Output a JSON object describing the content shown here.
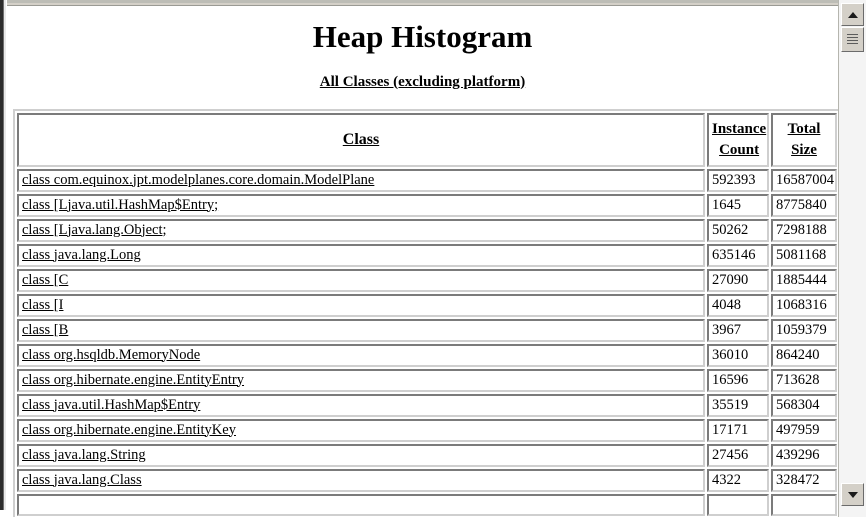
{
  "page": {
    "title": "Heap Histogram",
    "subtitle_link": "All Classes (excluding platform)"
  },
  "table": {
    "headers": {
      "class": "Class",
      "instance_count_line1": "Instance",
      "instance_count_line2": "Count",
      "total_size_line1": "Total",
      "total_size_line2": "Size"
    },
    "rows": [
      {
        "class": "class com.equinox.jpt.modelplanes.core.domain.ModelPlane",
        "count": "592393",
        "size": "16587004"
      },
      {
        "class": "class [Ljava.util.HashMap$Entry;",
        "count": "1645",
        "size": "8775840"
      },
      {
        "class": "class [Ljava.lang.Object;",
        "count": "50262",
        "size": "7298188"
      },
      {
        "class": "class java.lang.Long",
        "count": "635146",
        "size": "5081168"
      },
      {
        "class": "class [C",
        "count": "27090",
        "size": "1885444"
      },
      {
        "class": "class [I",
        "count": "4048",
        "size": "1068316"
      },
      {
        "class": "class [B",
        "count": "3967",
        "size": "1059379"
      },
      {
        "class": "class org.hsqldb.MemoryNode",
        "count": "36010",
        "size": "864240"
      },
      {
        "class": "class org.hibernate.engine.EntityEntry",
        "count": "16596",
        "size": "713628"
      },
      {
        "class": "class java.util.HashMap$Entry",
        "count": "35519",
        "size": "568304"
      },
      {
        "class": "class org.hibernate.engine.EntityKey",
        "count": "17171",
        "size": "497959"
      },
      {
        "class": "class java.lang.String",
        "count": "27456",
        "size": "439296"
      },
      {
        "class": "class java.lang.Class",
        "count": "4322",
        "size": "328472"
      },
      {
        "class": "",
        "count": "",
        "size": ""
      }
    ]
  },
  "scrollbar": {
    "up_arrow": "scroll-up",
    "down_arrow": "scroll-down",
    "thumb": "scroll-thumb"
  }
}
